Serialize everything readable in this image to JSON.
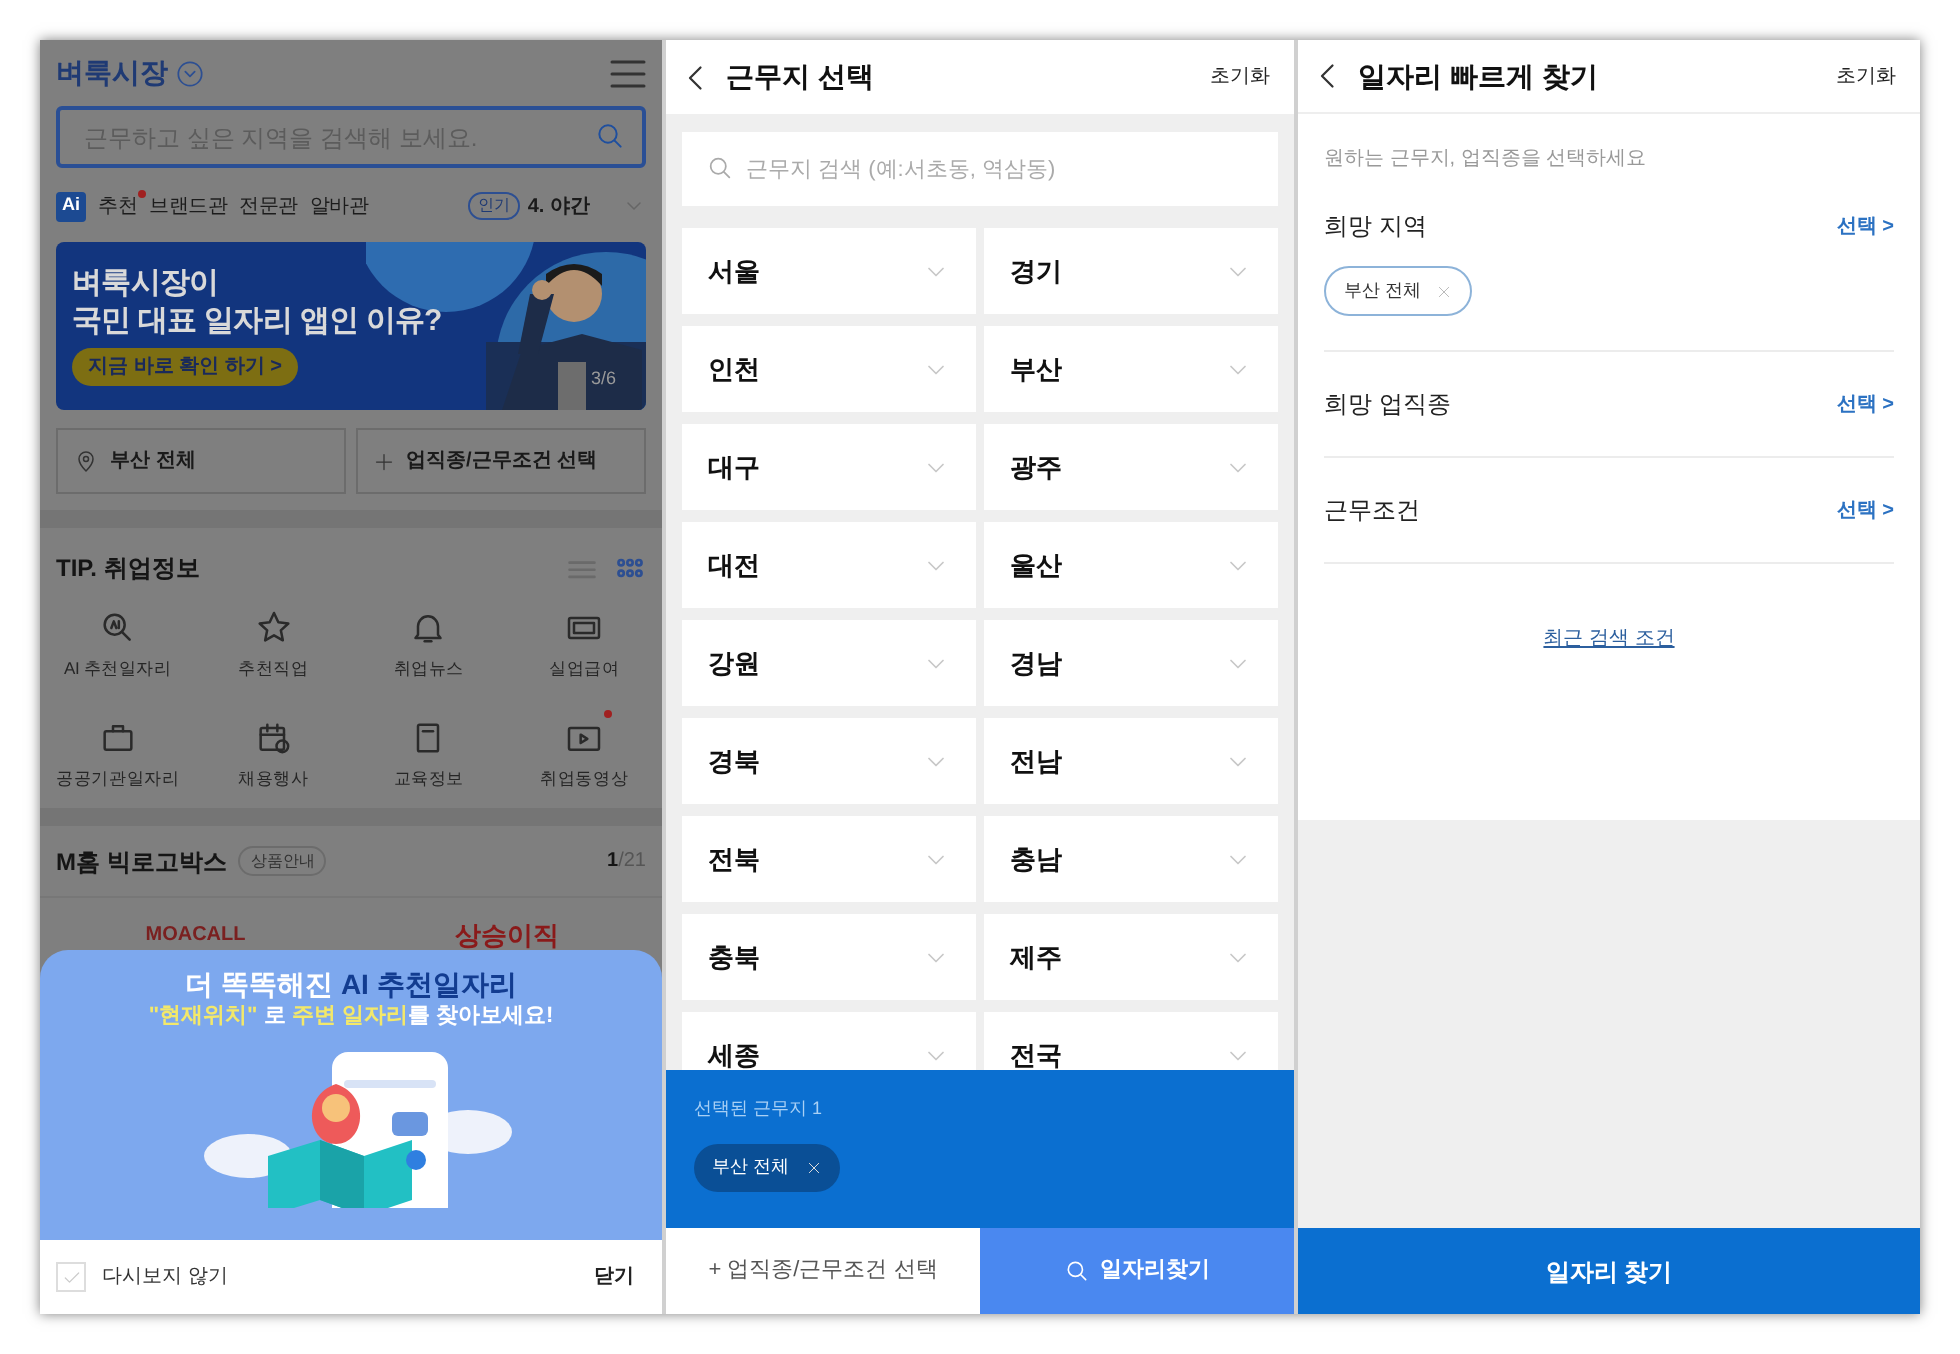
{
  "home_screen": {
    "logo": "벼룩시장",
    "search": {
      "placeholder": "근무하고 싶은 지역을 검색해 보세요."
    },
    "nav_badge": "Ai",
    "nav_tabs": [
      {
        "label": "추천",
        "new": true
      },
      {
        "label": "브랜드관",
        "new": false
      },
      {
        "label": "전문관",
        "new": false
      },
      {
        "label": "알바관",
        "new": false
      }
    ],
    "trending": {
      "badge": "인기",
      "text": "4. 야간"
    },
    "banner": {
      "lines": [
        "벼룩시장이",
        "국민 대표 일자리 앱인 이유?"
      ],
      "button": "지금 바로 확인 하기 >",
      "counter": "3/6"
    },
    "quick_buttons": [
      {
        "kind": "location",
        "label": "부산 전체"
      },
      {
        "kind": "add",
        "label": "업직종/근무조건 선택"
      }
    ],
    "tip": {
      "title": "TIP. 취업정보",
      "view_modes": [
        {
          "kind": "list",
          "selected": false
        },
        {
          "kind": "grid",
          "selected": true
        }
      ],
      "items": [
        {
          "kind": "ai",
          "label": "AI 추천일자리",
          "new": false
        },
        {
          "kind": "star",
          "label": "추천직업",
          "new": false
        },
        {
          "kind": "bell",
          "label": "취업뉴스",
          "new": false
        },
        {
          "kind": "money",
          "label": "실업급여",
          "new": false
        },
        {
          "kind": "bag",
          "label": "공공기관일자리",
          "new": false
        },
        {
          "kind": "calendar",
          "label": "채용행사",
          "new": false
        },
        {
          "kind": "book",
          "label": "교육정보",
          "new": false
        },
        {
          "kind": "video",
          "label": "취업동영상",
          "new": true
        }
      ]
    },
    "mhome": {
      "title": "M홈 빅로고박스",
      "pill": "상품안내",
      "page": "1",
      "total": "/21",
      "logos": [
        "MOACALL",
        "상승이직"
      ]
    },
    "popup": {
      "title": [
        {
          "text": "더 똑똑해진 ",
          "highlight": false
        },
        {
          "text": "AI 추천일자리",
          "highlight": true
        }
      ],
      "subtitle": [
        {
          "text": "\"현재위치\"",
          "highlight": true
        },
        {
          "text": " 로 ",
          "highlight": false
        },
        {
          "text": "주변 일자리",
          "highlight": true
        },
        {
          "text": "를 찾아보세요!",
          "highlight": false
        }
      ],
      "checkbox": {
        "label": "다시보지 않기",
        "checked": false
      },
      "close": "닫기"
    }
  },
  "region_screen": {
    "title": "근무지 선택",
    "reset": "초기화",
    "search": {
      "placeholder": "근무지 검색 (예:서초동, 역삼동)"
    },
    "regions": [
      "서울",
      "경기",
      "인천",
      "부산",
      "대구",
      "광주",
      "대전",
      "울산",
      "강원",
      "경남",
      "경북",
      "전남",
      "전북",
      "충남",
      "충북",
      "제주",
      "세종",
      "전국"
    ],
    "selected_label": "선택된 근무지 1",
    "selected_chips": [
      "부산 전체"
    ],
    "bottom_left": "+ 업직종/근무조건 선택",
    "bottom_right": "일자리찾기"
  },
  "quick_screen": {
    "title": "일자리 빠르게 찾기",
    "reset": "초기화",
    "hint": "원하는 근무지, 업직종을 선택하세요",
    "sections": [
      {
        "label": "희망 지역",
        "action": "선택 >",
        "chips": [
          "부산 전체"
        ]
      },
      {
        "label": "희망 업직종",
        "action": "선택 >"
      },
      {
        "label": "근무조건",
        "action": "선택 >"
      }
    ],
    "recent_link": "최근 검색 조건",
    "submit": "일자리 찾기"
  }
}
